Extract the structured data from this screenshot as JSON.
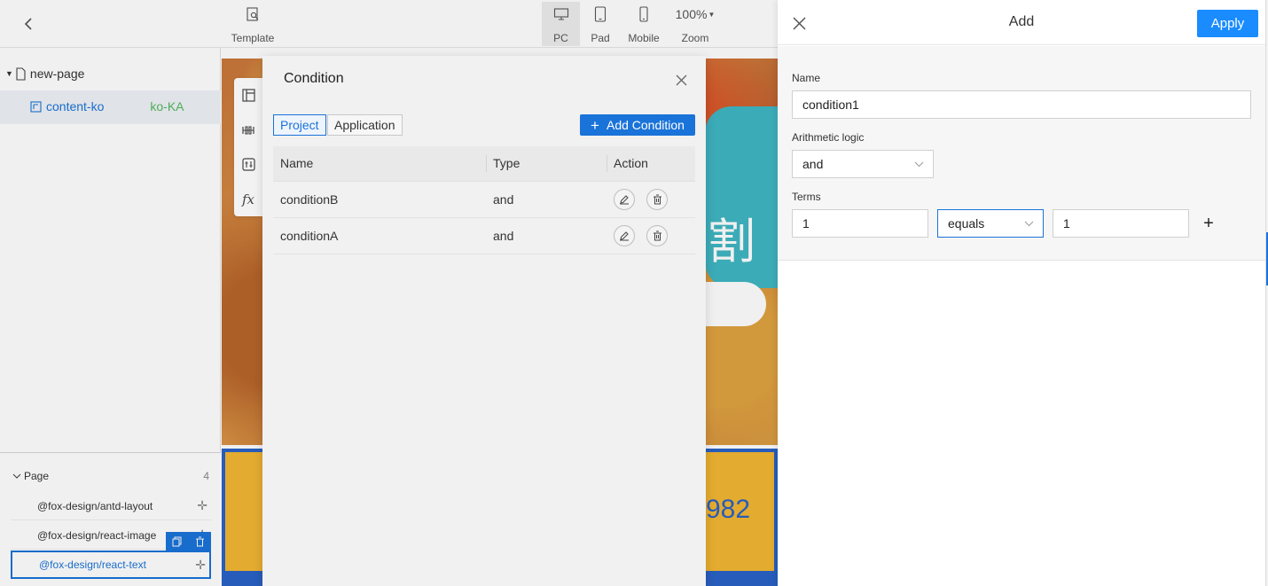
{
  "toolbar": {
    "template_label": "Template",
    "devices": [
      {
        "label": "PC",
        "icon": "monitor-icon",
        "active": true
      },
      {
        "label": "Pad",
        "icon": "tablet-icon",
        "active": false
      },
      {
        "label": "Mobile",
        "icon": "mobile-icon",
        "active": false
      }
    ],
    "zoom_value": "100%",
    "zoom_label": "Zoom"
  },
  "tree": {
    "root_label": "new-page",
    "child_label": "content-ko",
    "child_locale": "ko-KA"
  },
  "page_section": {
    "title": "Page",
    "count": "4",
    "packages": [
      "@fox-design/antd-layout",
      "@fox-design/react-image",
      "@fox-design/react-text"
    ]
  },
  "canvas": {
    "headline_char": "割",
    "number_text": "982"
  },
  "side_tools": [
    "layout-icon",
    "data-source-icon",
    "variable-icon",
    "function-icon"
  ],
  "function_icon_glyph": "fx",
  "condition_modal": {
    "title": "Condition",
    "tabs": [
      "Project",
      "Application"
    ],
    "active_tab": "Project",
    "add_button_label": "Add Condition",
    "columns": [
      "Name",
      "Type",
      "Action"
    ],
    "rows": [
      {
        "name": "conditionB",
        "type": "and"
      },
      {
        "name": "conditionA",
        "type": "and"
      }
    ]
  },
  "drawer": {
    "title": "Add",
    "apply_label": "Apply",
    "name_label": "Name",
    "name_value": "condition1",
    "logic_label": "Arithmetic logic",
    "logic_value": "and",
    "terms_label": "Terms",
    "term_left_value": "1",
    "term_operator": "equals",
    "term_right_value": "1",
    "add_term_glyph": "+"
  },
  "colors": {
    "primary": "#1a73d9",
    "apply": "#1a8cff",
    "locale_green": "#52b85c",
    "banner_yellow": "#f2b632"
  }
}
